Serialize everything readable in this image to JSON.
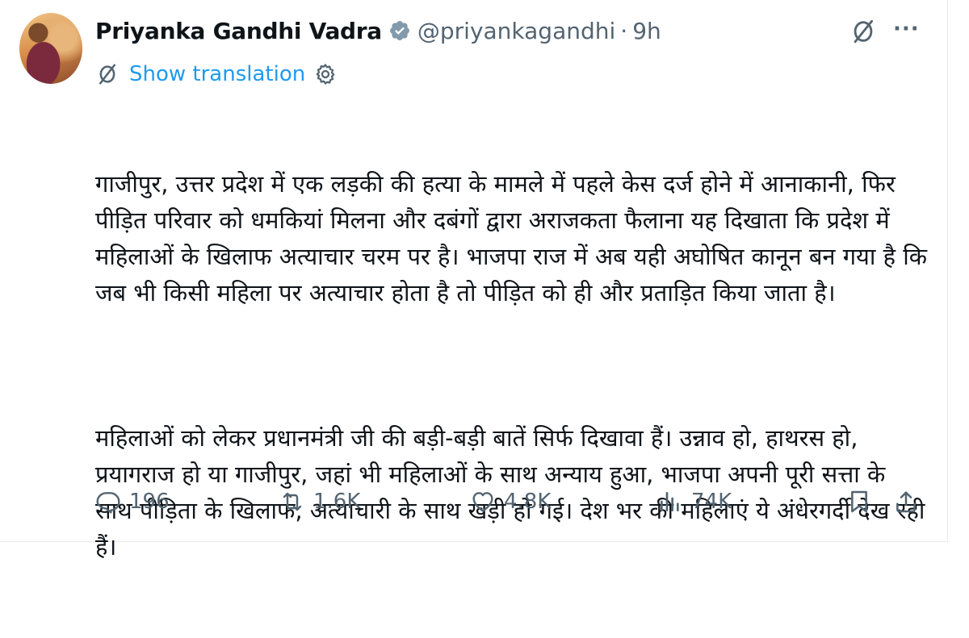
{
  "tweet": {
    "author_name": "Priyanka Gandhi Vadra",
    "handle": "@priyankagandhi",
    "separator": "·",
    "time": "9h",
    "more_label": "···",
    "translation_link": "Show translation",
    "paragraphs": [
      "गाजीपुर, उत्तर प्रदेश में एक लड़की की हत्या के मामले में पहले केस दर्ज होने में आनाकानी, फिर पीड़ित परिवार को धमकियां मिलना और दबंगों द्वारा अराजकता फैलाना यह दिखाता कि प्रदेश में महिलाओं के खिलाफ अत्याचार चरम पर है। भाजपा राज में अब यही अघोषित कानून बन गया है कि जब भी किसी महिला पर अत्याचार होता है तो पीड़ित को ही और प्रताड़ित किया जाता है।",
      "महिलाओं को लेकर प्रधानमंत्री जी की बड़ी-बड़ी बातें सिर्फ दिखावा हैं। उन्नाव हो, हाथरस हो, प्रयागराज हो या गाजीपुर, जहां भी महिलाओं के साथ अन्याय हुआ, भाजपा अपनी पूरी सत्ता के साथ पीड़िता के खिलाफ, अत्याचारी के साथ खड़ी हो गई। देश भर की महिलाएं ये अंधेरगर्दी देख रही हैं।"
    ],
    "stats": {
      "replies": "196",
      "reposts": "1.6K",
      "likes": "4.8K",
      "views": "74K"
    }
  },
  "icons": {
    "verified": "verified-badge-icon",
    "grok": "grok-icon",
    "more": "more-icon",
    "translate": "translate-icon",
    "settings": "gear-icon",
    "reply": "reply-icon",
    "repost": "repost-icon",
    "like": "heart-icon",
    "views": "views-icon",
    "bookmark": "bookmark-icon",
    "share": "share-icon"
  },
  "colors": {
    "accent": "#1d9bf0",
    "text": "#0f1419",
    "muted": "#536471",
    "verified_badge": "#829aab"
  }
}
